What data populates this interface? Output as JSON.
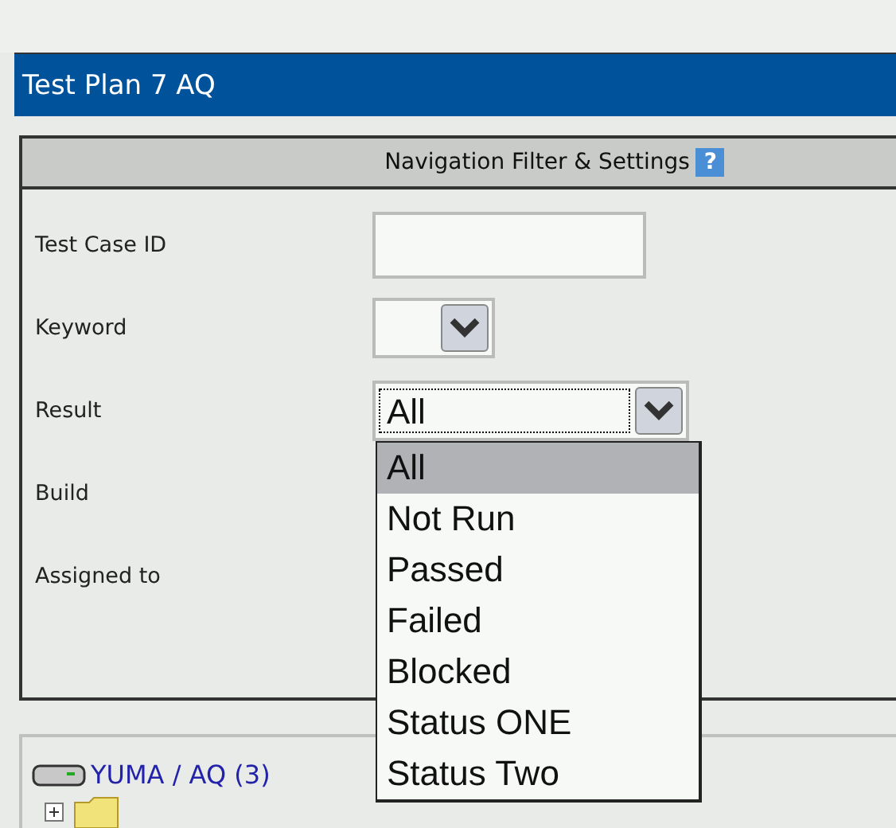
{
  "title": "Test Plan 7 AQ",
  "filter": {
    "heading": "Navigation Filter & Settings",
    "help_icon": "?",
    "fields": [
      {
        "label": "Test Case ID",
        "kind": "text"
      },
      {
        "label": "Keyword",
        "kind": "select"
      },
      {
        "label": "Result",
        "kind": "select",
        "value": "All",
        "open": true
      },
      {
        "label": "Build",
        "kind": "hidden"
      },
      {
        "label": "Assigned to",
        "kind": "hidden"
      }
    ]
  },
  "dropdown_options": [
    {
      "label": "All",
      "selected": true
    },
    {
      "label": "Not Run",
      "selected": false
    },
    {
      "label": "Passed",
      "selected": false
    },
    {
      "label": "Failed",
      "selected": false
    },
    {
      "label": "Blocked",
      "selected": false
    },
    {
      "label": "Status ONE",
      "selected": false
    },
    {
      "label": "Status Two",
      "selected": false
    }
  ],
  "tree": {
    "root": "YUMA / AQ (3)",
    "children": [
      {
        "kind": "folder",
        "expanded": false
      }
    ]
  }
}
